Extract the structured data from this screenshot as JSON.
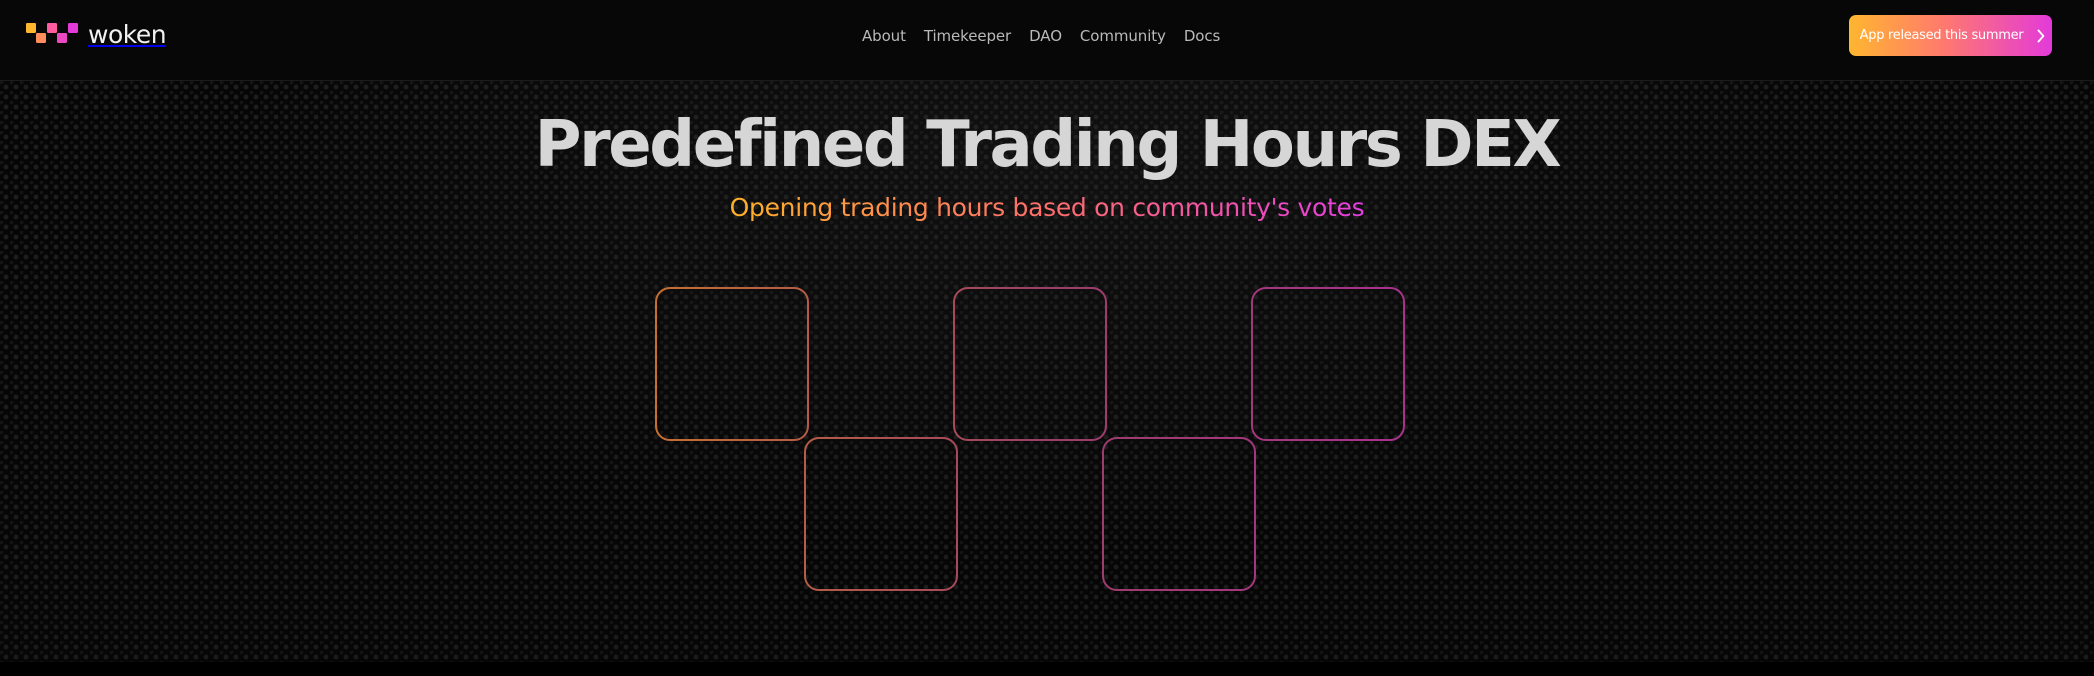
{
  "brand": {
    "name": "woken",
    "logo_icon": "woken-logo-icon",
    "colors": {
      "orange": "#ffb62f",
      "pink": "#e33ad9"
    }
  },
  "navigation": {
    "items": [
      {
        "label": "About"
      },
      {
        "label": "Timekeeper"
      },
      {
        "label": "DAO"
      },
      {
        "label": "Community"
      },
      {
        "label": "Docs"
      }
    ]
  },
  "header": {
    "cta_label": "App released this summer",
    "cta_icon": "chevron-right-icon"
  },
  "hero": {
    "title": "Predefined Trading Hours DEX",
    "subtitle": "Opening trading hours based on community's votes",
    "visual_icon": "checkerboard-outline-icon",
    "accent_colors": {
      "orange": "#c56f31",
      "pink": "#a9318c"
    }
  }
}
